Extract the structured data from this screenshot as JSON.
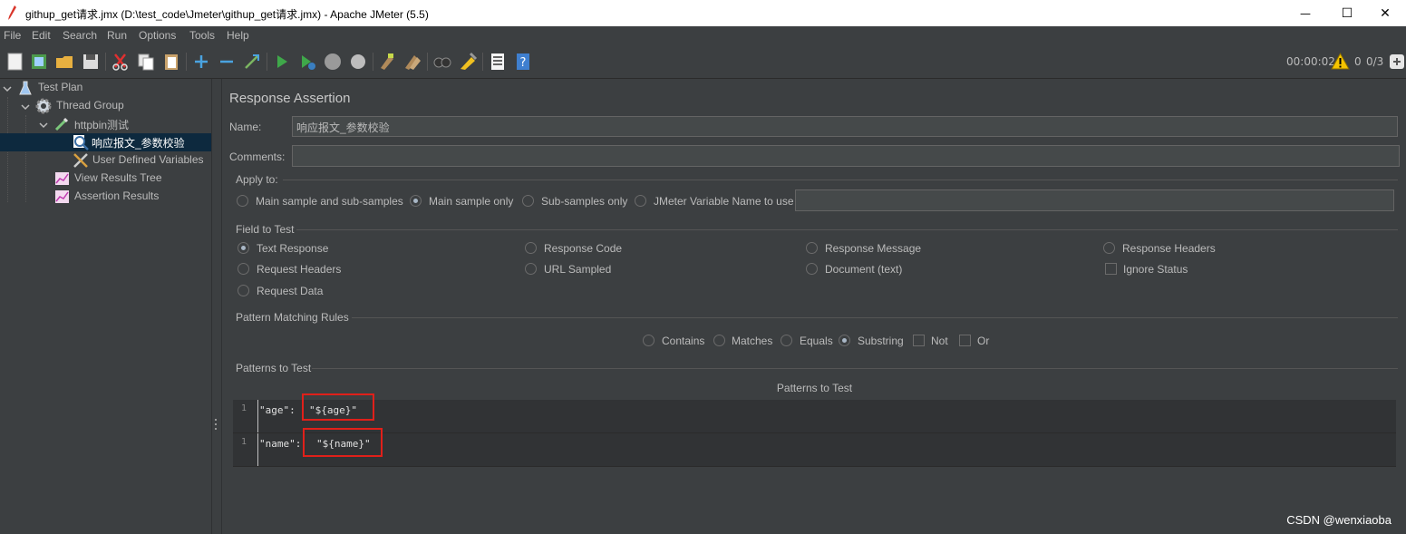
{
  "window": {
    "title": "githup_get请求.jmx (D:\\test_code\\Jmeter\\githup_get请求.jmx) - Apache JMeter (5.5)",
    "minimize_glyph": "—",
    "maximize_glyph": "☐",
    "close_glyph": "✕"
  },
  "menu": [
    "File",
    "Edit",
    "Search",
    "Run",
    "Options",
    "Tools",
    "Help"
  ],
  "toolbar": {
    "elapsed": "00:00:02",
    "warnings": "0",
    "threads": "0/3"
  },
  "tree": {
    "items": [
      {
        "label": "Test Plan",
        "icon": "flask-icon"
      },
      {
        "label": "Thread Group",
        "icon": "gear-icon"
      },
      {
        "label": "httpbin测试",
        "icon": "pipette-icon"
      },
      {
        "label": "响应报文_参数校验",
        "icon": "magnifier-icon"
      },
      {
        "label": "User Defined Variables",
        "icon": "tools-icon"
      },
      {
        "label": "View Results Tree",
        "icon": "graph-icon"
      },
      {
        "label": "Assertion Results",
        "icon": "graph-icon"
      }
    ]
  },
  "panel": {
    "heading": "Response Assertion",
    "name_label": "Name:",
    "name_value": "响应报文_参数校验",
    "comments_label": "Comments:",
    "comments_value": "",
    "apply_to": {
      "title": "Apply to:",
      "options": [
        "Main sample and sub-samples",
        "Main sample only",
        "Sub-samples only",
        "JMeter Variable Name to use"
      ],
      "selected": "Main sample only",
      "variable_value": ""
    },
    "field_to_test": {
      "title": "Field to Test",
      "options": [
        "Text Response",
        "Response Code",
        "Response Message",
        "Response Headers",
        "Request Headers",
        "URL Sampled",
        "Document (text)",
        "Ignore Status",
        "Request Data"
      ],
      "selected": "Text Response"
    },
    "pattern_rules": {
      "title": "Pattern Matching Rules",
      "options": [
        "Contains",
        "Matches",
        "Equals",
        "Substring",
        "Not",
        "Or"
      ],
      "selected": "Substring"
    },
    "patterns": {
      "title": "Patterns to Test",
      "column": "Patterns to Test",
      "rows": [
        {
          "line": "1",
          "key": "\"age\": ",
          "value": "\"${age}\""
        },
        {
          "line": "1",
          "key": "\"name\": ",
          "value": "\"${name}\""
        }
      ]
    }
  },
  "watermark": "CSDN @wenxiaoba",
  "colors": {
    "accent_red": "#e0201a",
    "selection": "#0d293e"
  }
}
